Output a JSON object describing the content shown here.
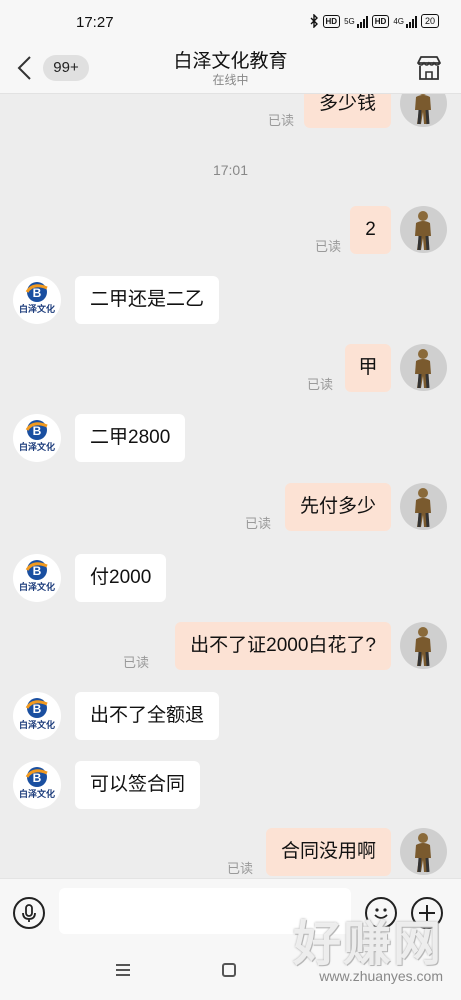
{
  "status_bar": {
    "time": "17:27",
    "net1": "5G",
    "net2": "4G",
    "hd": "HD",
    "battery": "20"
  },
  "header": {
    "unread_count": "99+",
    "title": "白泽文化教育",
    "subtitle": "在线中"
  },
  "chat": {
    "read_label": "已读",
    "time_divider": "17:01",
    "messages": [
      {
        "side": "right",
        "text": "多少钱"
      },
      {
        "side": "right",
        "text": "2"
      },
      {
        "side": "left",
        "text": "二甲还是二乙"
      },
      {
        "side": "right",
        "text": "甲"
      },
      {
        "side": "left",
        "text": "二甲2800"
      },
      {
        "side": "right",
        "text": "先付多少"
      },
      {
        "side": "left",
        "text": "付2000"
      },
      {
        "side": "right",
        "text": "出不了证2000白花了?"
      },
      {
        "side": "left",
        "text": "出不了全额退"
      },
      {
        "side": "left",
        "text": "可以签合同"
      },
      {
        "side": "right",
        "text": "合同没用啊"
      }
    ],
    "logo_text": "白泽文化"
  },
  "input": {
    "placeholder": ""
  },
  "icons": {
    "back": "back-arrow-icon",
    "shop": "shop-icon",
    "voice": "voice-icon",
    "emoji": "emoji-icon",
    "plus": "plus-icon"
  },
  "watermark": {
    "big": "好赚网",
    "small": "www.zhuanyes.com"
  },
  "colors": {
    "bubble_self": "#fce2d4",
    "bubble_other": "#ffffff",
    "background": "#ededed"
  }
}
